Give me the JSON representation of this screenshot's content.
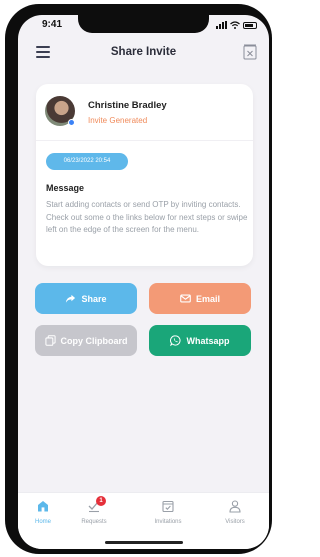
{
  "status_bar": {
    "time": "9:41"
  },
  "header": {
    "title": "Share Invite"
  },
  "card": {
    "contact_name": "Christine Bradley",
    "status": "Invite Generated",
    "date": "06/23/2022 20:54",
    "message_label": "Message",
    "message_body": "Start adding contacts or send OTP by inviting contacts. Check out some o the links below for next steps or swipe left on the edge of the screen for the menu."
  },
  "actions": {
    "share": "Share",
    "email": "Email",
    "copy": "Copy Clipboard",
    "whatsapp": "Whatsapp"
  },
  "bottom_nav": {
    "items": [
      {
        "label": "Home",
        "icon": "home-icon"
      },
      {
        "label": "Requests",
        "icon": "requests-icon",
        "badge": "1"
      },
      {
        "label": "Invitations",
        "icon": "invitations-icon"
      },
      {
        "label": "Visitors",
        "icon": "visitors-icon"
      }
    ]
  },
  "colors": {
    "share": "#5cb8ea",
    "email": "#f39a76",
    "copy": "#c6c6cc",
    "whatsapp": "#1aa679",
    "status": "#f08a5a",
    "badge": "#e5303a"
  }
}
